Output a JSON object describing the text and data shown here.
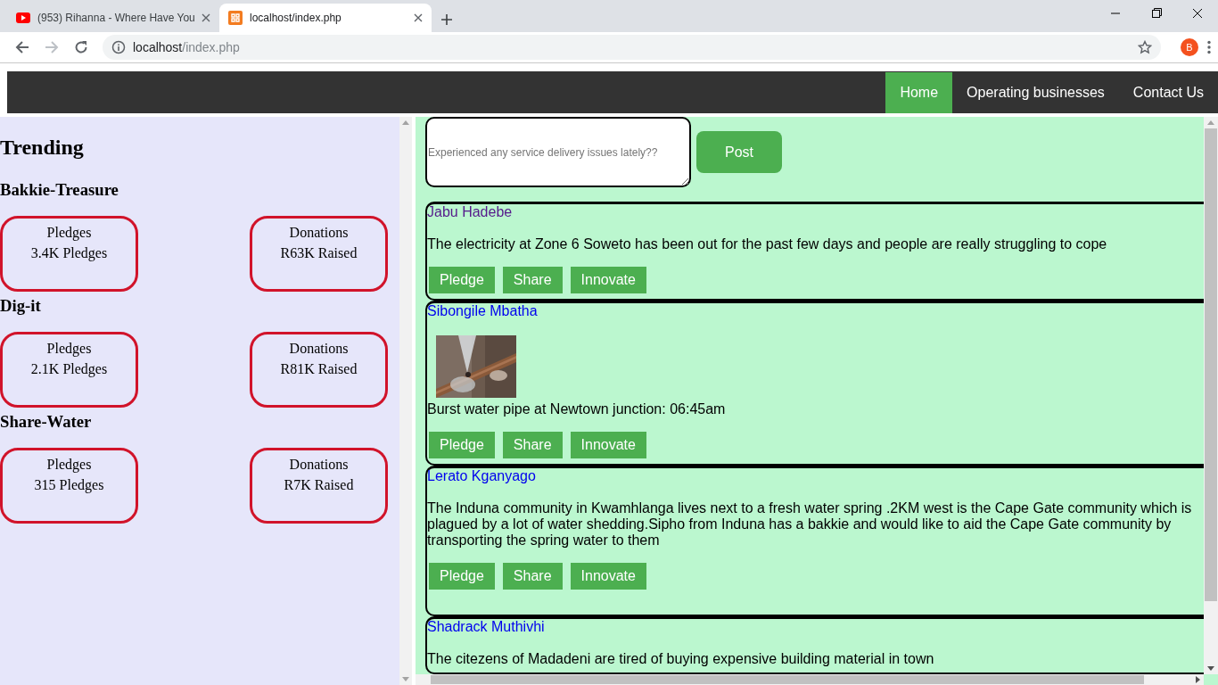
{
  "browser": {
    "tabs": [
      {
        "title": "(953) Rihanna - Where Have You",
        "kind": "video",
        "selected": false
      },
      {
        "title": "localhost/index.php",
        "kind": "server",
        "selected": true
      }
    ],
    "address": {
      "host": "localhost",
      "path": "/index.php"
    },
    "profile_initial": "B"
  },
  "nav": {
    "items": [
      {
        "label": "Home",
        "selected": true
      },
      {
        "label": "Operating businesses",
        "selected": false
      },
      {
        "label": "Contact Us",
        "selected": false
      }
    ]
  },
  "trending": {
    "title": "Trending",
    "projects": [
      {
        "name": "Bakkie-Treasure",
        "pledges": {
          "label": "Pledges",
          "value": "3.4K Pledges"
        },
        "donations": {
          "label": "Donations",
          "value": "R63K Raised"
        }
      },
      {
        "name": "Dig-it",
        "pledges": {
          "label": "Pledges",
          "value": "2.1K Pledges"
        },
        "donations": {
          "label": "Donations",
          "value": "R81K Raised"
        }
      },
      {
        "name": "Share-Water",
        "pledges": {
          "label": "Pledges",
          "value": "315 Pledges"
        },
        "donations": {
          "label": "Donations",
          "value": "R7K Raised"
        }
      }
    ]
  },
  "composer": {
    "placeholder": "Experienced any service delivery issues lately??",
    "button": "Post"
  },
  "posts": [
    {
      "author": "Jabu Hadebe",
      "visited": true,
      "text": "The electricity at Zone 6 Soweto has been out for the past few days and people are really struggling to cope",
      "actions": [
        "Pledge",
        "Share",
        "Innovate"
      ]
    },
    {
      "author": "Sibongile Mbatha",
      "visited": false,
      "media": {
        "kind": "picture"
      },
      "text": "Burst water pipe at Newtown junction: 06:45am",
      "actions": [
        "Pledge",
        "Share",
        "Innovate"
      ]
    },
    {
      "author": "Lerato Kganyago",
      "visited": false,
      "text": "The Induna community in Kwamhlanga lives next to a fresh water spring .2KM west is the Cape Gate community which is plagued by a lot of water shedding.Sipho from Induna has a bakkie and would like to aid the Cape Gate community by transporting the spring water to them",
      "actions": [
        "Pledge",
        "Share",
        "Innovate"
      ]
    },
    {
      "author": "Shadrack Muthivhi",
      "visited": false,
      "text": "The citezens of Madadeni are tired of buying expensive building material in town"
    }
  ]
}
